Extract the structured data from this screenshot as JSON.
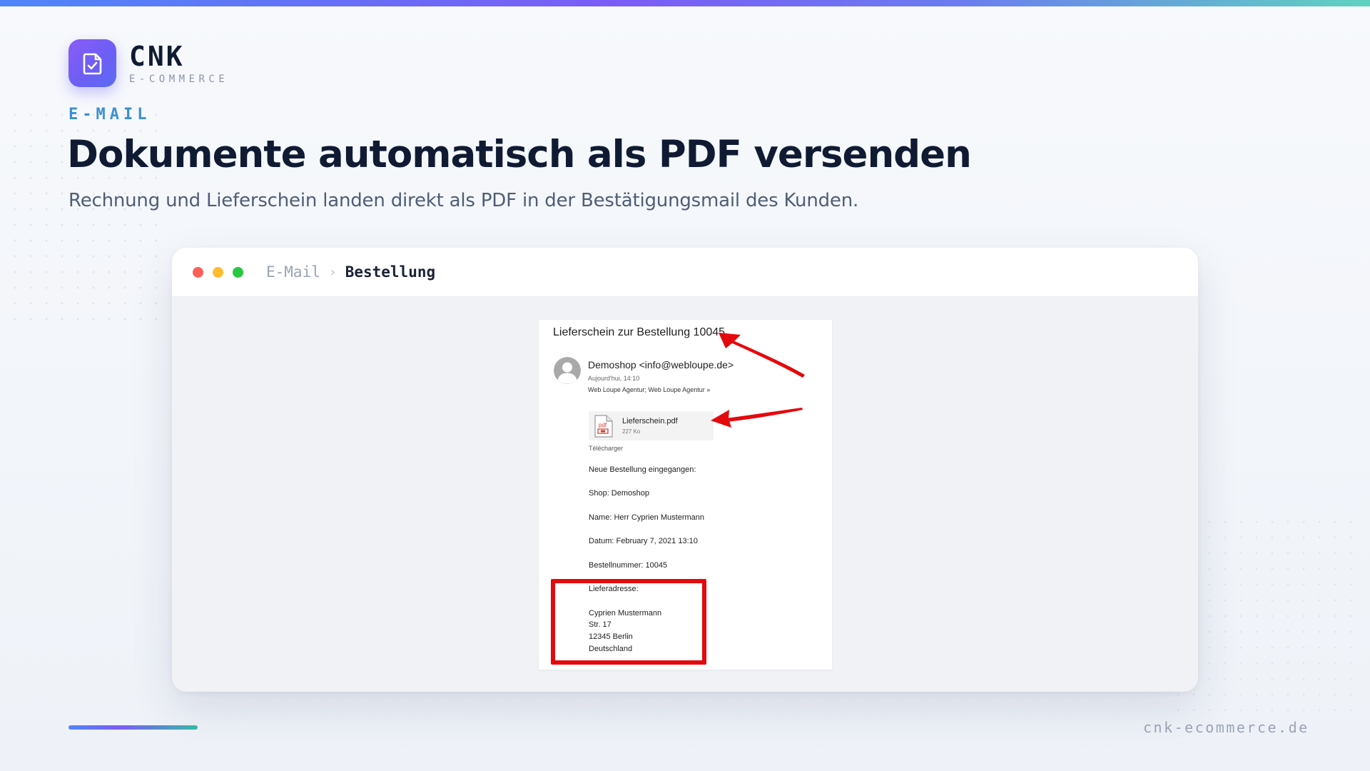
{
  "brand": {
    "name": "CNK",
    "subtitle": "E-COMMERCE",
    "logo_icon": "document-check-icon",
    "accent_color": "#7b5cf5"
  },
  "hero": {
    "eyebrow": "E-MAIL",
    "title": "Dokumente automatisch als PDF versenden",
    "subtitle": "Rechnung und Lieferschein landen direkt als PDF in der Bestätigungsmail des Kunden."
  },
  "window": {
    "breadcrumb": {
      "parent": "E-Mail",
      "separator": "›",
      "current": "Bestellung"
    }
  },
  "email": {
    "subject": "Lieferschein zur Bestellung 10045",
    "sender": "Demoshop <info@webloupe.de>",
    "date": "Aujourd'hui, 14:10",
    "recipients": "Web Loupe Agentur; Web Loupe Agentur »",
    "attachment": {
      "name": "Lieferschein.pdf",
      "size": "227 Ko",
      "icon": "pdf-file-icon"
    },
    "download_label": "Télécharger",
    "body": {
      "intro": "Neue Bestellung eingegangen:",
      "shop": "Shop: Demoshop",
      "name": "Name: Herr Cyprien Mustermann",
      "date": "Datum: February 7, 2021 13:10",
      "order_number": "Bestellnummer: 10045",
      "address_label": "Lieferadresse:",
      "address_lines": [
        "Cyprien Mustermann",
        "Str. 17",
        "12345 Berlin",
        "Deutschland"
      ]
    },
    "annotation_color": "#e4090d"
  },
  "footer": {
    "url": "cnk-ecommerce.de"
  }
}
